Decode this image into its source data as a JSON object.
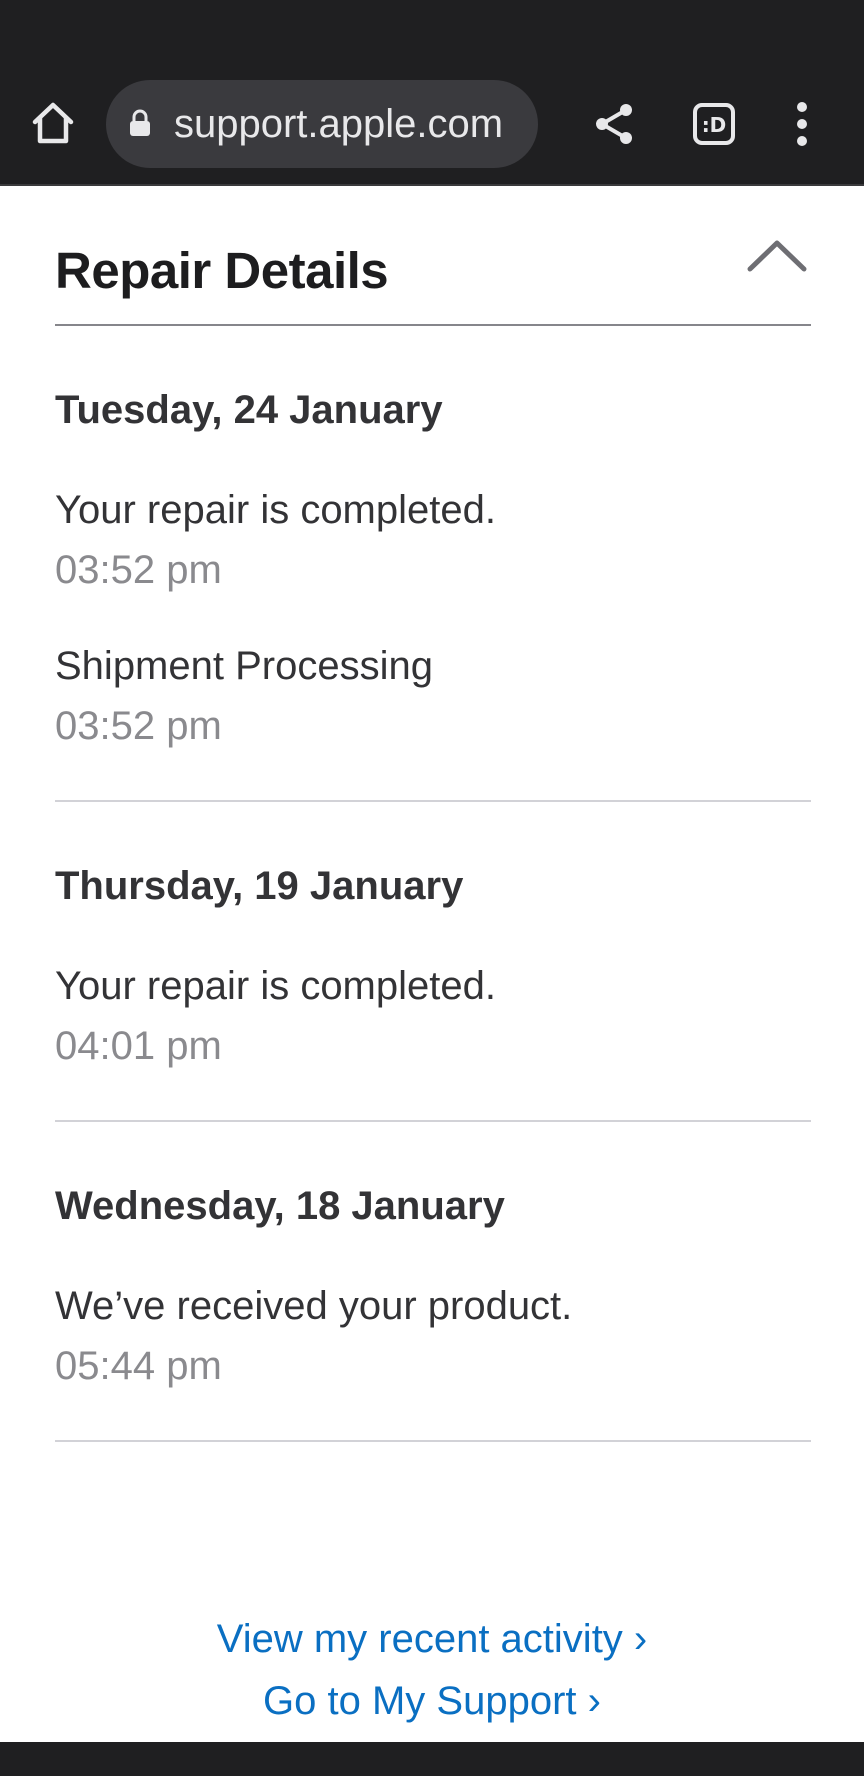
{
  "browser": {
    "url": "support.apple.com"
  },
  "header": {
    "title": "Repair Details"
  },
  "days": [
    {
      "date": "Tuesday, 24 January",
      "events": [
        {
          "title": "Your repair is completed.",
          "time": "03:52 pm"
        },
        {
          "title": "Shipment Processing",
          "time": "03:52 pm"
        }
      ]
    },
    {
      "date": "Thursday, 19 January",
      "events": [
        {
          "title": "Your repair is completed.",
          "time": "04:01 pm"
        }
      ]
    },
    {
      "date": "Wednesday, 18 January",
      "events": [
        {
          "title": "We’ve received your product.",
          "time": "05:44 pm"
        }
      ]
    }
  ],
  "links": {
    "recent_activity": "View my recent activity ›",
    "my_support": "Go to My Support ›"
  },
  "colors": {
    "link": "#0a6fc2",
    "browser_bar": "#1f1f21"
  },
  "icons": [
    "home-icon",
    "lock-icon",
    "share-icon",
    "tab-switcher-icon",
    "more-vert-icon",
    "chevron-up-icon"
  ]
}
